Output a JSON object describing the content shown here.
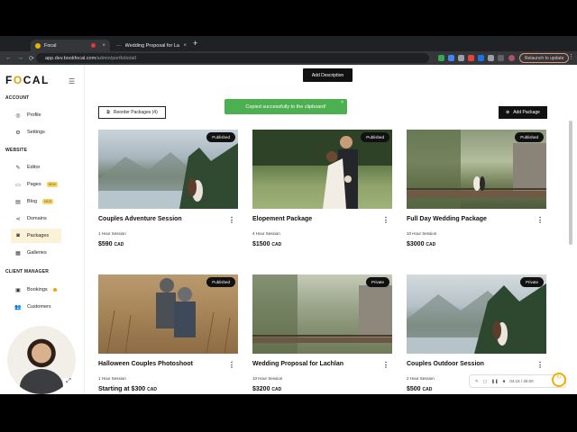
{
  "browser": {
    "tabs": [
      {
        "title": "Focal",
        "active": true
      },
      {
        "title": "Wedding Proposal for Lachlan",
        "active": false
      }
    ],
    "url_host": "app.dev.bookfocal.com",
    "url_path": "/admin/portfolio/all",
    "relaunch_label": "Relaunch to update"
  },
  "sidebar": {
    "logo_pre": "F",
    "logo_o": "O",
    "logo_post": "CAL",
    "sections": [
      {
        "title": "ACCOUNT",
        "items": [
          {
            "label": "Profile",
            "icon": "user-circle-icon"
          },
          {
            "label": "Settings",
            "icon": "gear-icon"
          }
        ]
      },
      {
        "title": "WEBSITE",
        "items": [
          {
            "label": "Editor",
            "icon": "pencil-icon"
          },
          {
            "label": "Pages",
            "icon": "monitor-icon",
            "badge": "NEW"
          },
          {
            "label": "Blog",
            "icon": "blog-icon",
            "badge": "NEW"
          },
          {
            "label": "Domains",
            "icon": "share-icon"
          },
          {
            "label": "Packages",
            "icon": "camera-icon",
            "selected": true
          },
          {
            "label": "Galleries",
            "icon": "grid-icon"
          }
        ]
      },
      {
        "title": "CLIENT MANAGER",
        "items": [
          {
            "label": "Bookings",
            "icon": "calendar-icon",
            "dot": true
          },
          {
            "label": "Customers",
            "icon": "users-icon"
          }
        ]
      }
    ]
  },
  "toolbar": {
    "add_description": "Add Description",
    "reorder_label": "Reorder Packages (4)",
    "add_package_label": "Add Package"
  },
  "toast": {
    "message": "Copied successfully to the clipboard!"
  },
  "packages": [
    {
      "title": "Couples Adventure Session",
      "session": "1 Hour Session",
      "price": "$590",
      "currency": "CAD",
      "status": "Published"
    },
    {
      "title": "Elopement Package",
      "session": "4 Hour Session",
      "price": "$1500",
      "currency": "CAD",
      "status": "Published"
    },
    {
      "title": "Full Day Wedding Package",
      "session": "10 Hour Session",
      "price": "$3000",
      "currency": "CAD",
      "status": "Published"
    },
    {
      "title": "Halloween Couples Photoshoot",
      "session": "1 Hour Session",
      "price": "Starting at $300",
      "currency": "CAD",
      "status": "Published"
    },
    {
      "title": "Wedding Proposal for Lachlan",
      "session": "10 Hour Session",
      "price": "$3200",
      "currency": "CAD",
      "status": "Private"
    },
    {
      "title": "Couples Outdoor Session",
      "session": "2 Hour Session",
      "price": "$500",
      "currency": "CAD",
      "status": "Private"
    }
  ],
  "recorder": {
    "time": "04:15 / 30:00"
  }
}
